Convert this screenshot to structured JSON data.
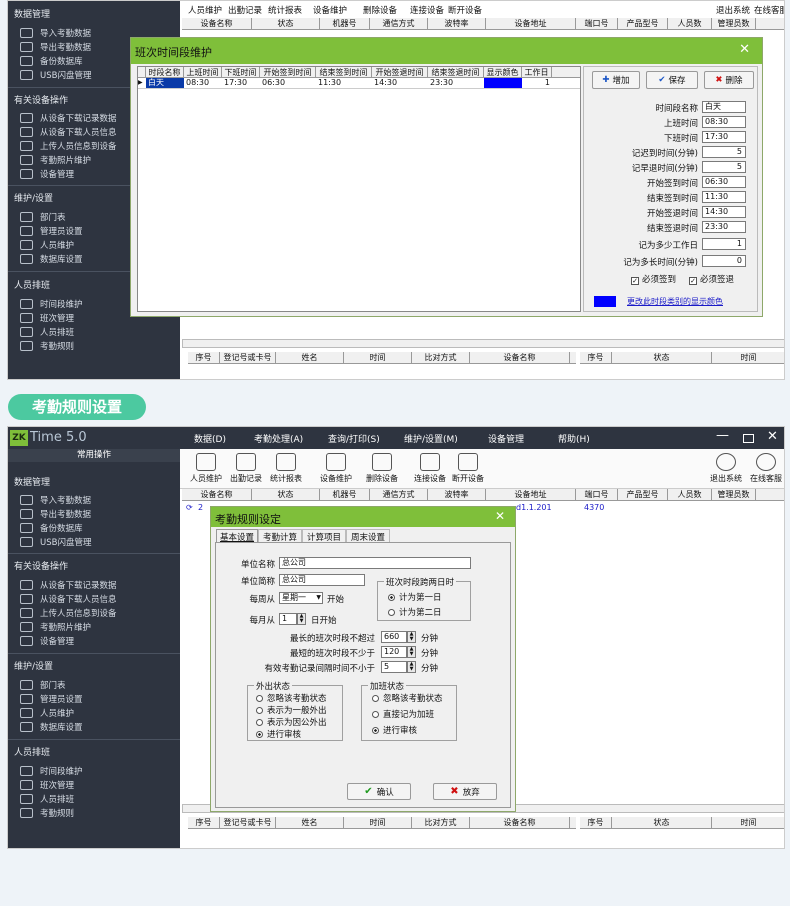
{
  "top": {
    "sidebar": {
      "sections": [
        {
          "title": "数据管理",
          "items": [
            "导入考勤数据",
            "导出考勤数据",
            "备份数据库",
            "USB闪盘管理"
          ]
        },
        {
          "title": "有关设备操作",
          "items": [
            "从设备下载记录数据",
            "从设备下载人员信息",
            "上传人员信息到设备",
            "考勤照片维护",
            "设备管理"
          ]
        },
        {
          "title": "维护/设置",
          "items": [
            "部门表",
            "管理员设置",
            "人员维护",
            "数据库设置"
          ]
        },
        {
          "title": "人员排班",
          "items": [
            "时间段维护",
            "班次管理",
            "人员排班",
            "考勤规则"
          ]
        }
      ]
    },
    "toolbar_labels": [
      "人员维护",
      "出勤记录",
      "统计报表",
      "设备维护",
      "删除设备",
      "连接设备",
      "断开设备",
      "退出系统",
      "在线客服"
    ],
    "device_columns": [
      "设备名称",
      "状态",
      "机器号",
      "通信方式",
      "波特率",
      "设备地址",
      "端口号",
      "产品型号",
      "人员数",
      "管理员数"
    ],
    "bottom_columns_left": [
      "序号",
      "登记号或卡号",
      "姓名",
      "时间",
      "比对方式",
      "设备名称"
    ],
    "bottom_columns_right": [
      "序号",
      "状态",
      "时间"
    ],
    "dialog": {
      "title": "班次时间段维护",
      "close": "✕",
      "grid_columns": [
        "时段名称",
        "上班时间",
        "下班时间",
        "开始签到时间",
        "结束签到时间",
        "开始签退时间",
        "结束签退时间",
        "显示颜色",
        "工作日"
      ],
      "grid_row": [
        "白天",
        "08:30",
        "17:30",
        "06:30",
        "11:30",
        "14:30",
        "23:30",
        "",
        "1"
      ],
      "row_color": "#0000ff",
      "buttons": {
        "add": "增加",
        "save": "保存",
        "delete": "删除"
      },
      "fields": [
        {
          "label": "时间段名称",
          "value": "白天"
        },
        {
          "label": "上班时间",
          "value": "08:30"
        },
        {
          "label": "下班时间",
          "value": "17:30"
        },
        {
          "label": "记迟到时间(分钟)",
          "value": "5"
        },
        {
          "label": "记早退时间(分钟)",
          "value": "5"
        },
        {
          "label": "开始签到时间",
          "value": "06:30"
        },
        {
          "label": "结束签到时间",
          "value": "11:30"
        },
        {
          "label": "开始签退时间",
          "value": "14:30"
        },
        {
          "label": "结束签退时间",
          "value": "23:30"
        },
        {
          "label": "记为多少工作日",
          "value": "1"
        },
        {
          "label": "记为多长时间(分钟)",
          "value": "0"
        }
      ],
      "must_signin": "必须签到",
      "must_signout": "必须签退",
      "color_link": "更改此时段类别的显示颜色"
    }
  },
  "section_badge": "考勤规则设置",
  "bottom": {
    "app_title": "Time 5.0",
    "logo": "ZK",
    "menu": [
      "数据(D)",
      "考勤处理(A)",
      "查询/打印(S)",
      "维护/设置(M)",
      "设备管理",
      "帮助(H)"
    ],
    "common_ops": "常用操作",
    "toolbar_labels": [
      "人员维护",
      "出勤记录",
      "统计报表",
      "设备维护",
      "删除设备",
      "连接设备",
      "断开设备",
      "退出系统",
      "在线客服"
    ],
    "device_columns": [
      "设备名称",
      "状态",
      "机器号",
      "通信方式",
      "波特率",
      "设备地址",
      "端口号",
      "产品型号",
      "人员数",
      "管理员数"
    ],
    "device_row": {
      "name": "2",
      "address": "d1.1.201",
      "port": "4370"
    },
    "bottom_columns_left": [
      "序号",
      "登记号或卡号",
      "姓名",
      "时间",
      "比对方式",
      "设备名称"
    ],
    "bottom_columns_right": [
      "序号",
      "状态",
      "时间"
    ],
    "dialog": {
      "title": "考勤规则设定",
      "tabs": [
        "基本设置",
        "考勤计算",
        "计算项目",
        "周末设置"
      ],
      "unit_name_label": "单位名称",
      "unit_name": "总公司",
      "unit_short_label": "单位简称",
      "unit_short": "总公司",
      "week_label": "每周从",
      "week_value": "星期一",
      "week_suffix": "开始",
      "month_label": "每月从",
      "month_value": "1",
      "month_suffix": "日开始",
      "cross_group": "班次时段跨两日时",
      "cross_opts": [
        "计为第一日",
        "计为第二日"
      ],
      "longest_label": "最长的班次时段不超过",
      "longest_value": "660",
      "shortest_label": "最短的班次时段不少于",
      "shortest_value": "120",
      "interval_label": "有效考勤记录间隔时间不小于",
      "interval_value": "5",
      "minute": "分钟",
      "out_group": "外出状态",
      "out_opts": [
        "忽略该考勤状态",
        "表示为一般外出",
        "表示为因公外出",
        "进行审核"
      ],
      "ot_group": "加班状态",
      "ot_opts": [
        "忽略该考勤状态",
        "直接记为加班",
        "进行审核"
      ],
      "ok": "确认",
      "cancel": "放弃"
    }
  },
  "colors": {
    "accent": "#7fbf3a",
    "badge": "#4cc9a0",
    "sidebar": "#2e3440"
  }
}
